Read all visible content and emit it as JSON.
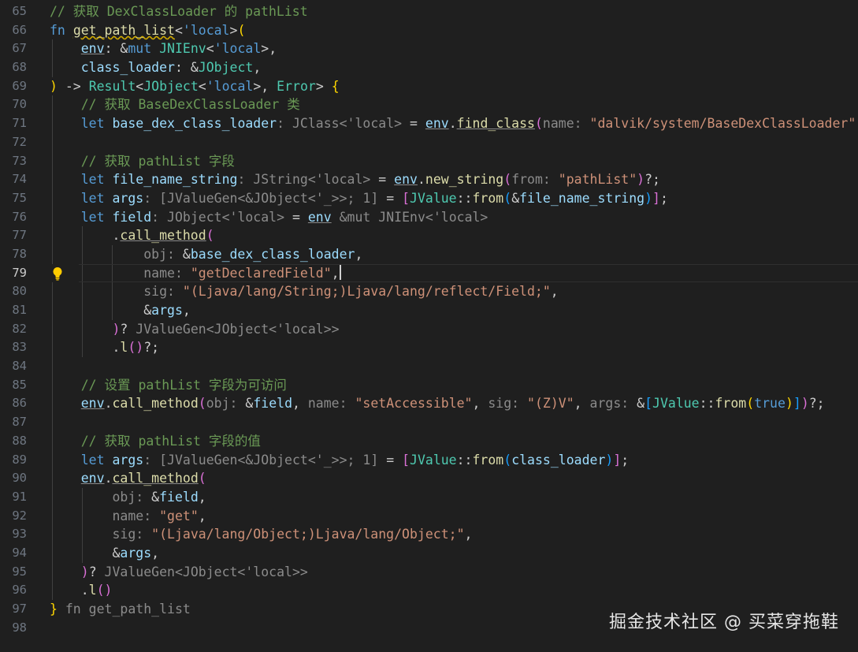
{
  "editor": {
    "current_line": 79,
    "lines": [
      {
        "n": 65,
        "tokens": [
          [
            "cm",
            "// 获取 DexClassLoader 的 pathList"
          ]
        ]
      },
      {
        "n": 66,
        "tokens": [
          [
            "kw",
            "fn "
          ],
          [
            "fn sq",
            "get_path_list"
          ],
          [
            "pn",
            "<"
          ],
          [
            "lt",
            "'local"
          ],
          [
            "pn",
            ">"
          ],
          [
            "b1",
            "("
          ]
        ]
      },
      {
        "n": 67,
        "guides": 1,
        "tokens": [
          [
            "pn",
            "    "
          ],
          [
            "va ul",
            "env"
          ],
          [
            "pn",
            ": &"
          ],
          [
            "kw",
            "mut "
          ],
          [
            "ty",
            "JNIEnv"
          ],
          [
            "pn",
            "<"
          ],
          [
            "lt",
            "'local"
          ],
          [
            "pn",
            ">,"
          ]
        ]
      },
      {
        "n": 68,
        "guides": 1,
        "tokens": [
          [
            "pn",
            "    "
          ],
          [
            "va",
            "class_loader"
          ],
          [
            "pn",
            ": &"
          ],
          [
            "ty",
            "JObject"
          ],
          [
            "pn",
            ","
          ]
        ]
      },
      {
        "n": 69,
        "tokens": [
          [
            "b1",
            ")"
          ],
          [
            "pn",
            " -> "
          ],
          [
            "ty",
            "Result"
          ],
          [
            "pn",
            "<"
          ],
          [
            "ty",
            "JObject"
          ],
          [
            "pn",
            "<"
          ],
          [
            "lt",
            "'local"
          ],
          [
            "pn",
            ">, "
          ],
          [
            "ty",
            "Error"
          ],
          [
            "pn",
            "> "
          ],
          [
            "b1",
            "{"
          ]
        ]
      },
      {
        "n": 70,
        "guides": 1,
        "tokens": [
          [
            "pn",
            "    "
          ],
          [
            "cm",
            "// 获取 BaseDexClassLoader 类"
          ]
        ]
      },
      {
        "n": 71,
        "guides": 1,
        "tokens": [
          [
            "pn",
            "    "
          ],
          [
            "kw",
            "let "
          ],
          [
            "va",
            "base_dex_class_loader"
          ],
          [
            "h",
            ": JClass<'local>"
          ],
          [
            "pn",
            " = "
          ],
          [
            "va ul",
            "env"
          ],
          [
            "pn",
            "."
          ],
          [
            "fn ul",
            "find_class"
          ],
          [
            "b2",
            "("
          ],
          [
            "h",
            "name: "
          ],
          [
            "st",
            "\"dalvik/system/BaseDexClassLoader\""
          ],
          [
            "b2",
            ")"
          ],
          [
            "pn",
            "?;"
          ]
        ]
      },
      {
        "n": 72,
        "guides": 1,
        "tokens": []
      },
      {
        "n": 73,
        "guides": 1,
        "tokens": [
          [
            "pn",
            "    "
          ],
          [
            "cm",
            "// 获取 pathList 字段"
          ]
        ]
      },
      {
        "n": 74,
        "guides": 1,
        "tokens": [
          [
            "pn",
            "    "
          ],
          [
            "kw",
            "let "
          ],
          [
            "va",
            "file_name_string"
          ],
          [
            "h",
            ": JString<'local>"
          ],
          [
            "pn",
            " = "
          ],
          [
            "va ul",
            "env"
          ],
          [
            "pn",
            "."
          ],
          [
            "fn",
            "new_string"
          ],
          [
            "b2",
            "("
          ],
          [
            "h",
            "from: "
          ],
          [
            "st",
            "\"pathList\""
          ],
          [
            "b2",
            ")"
          ],
          [
            "pn",
            "?;"
          ]
        ]
      },
      {
        "n": 75,
        "guides": 1,
        "tokens": [
          [
            "pn",
            "    "
          ],
          [
            "kw",
            "let "
          ],
          [
            "va",
            "args"
          ],
          [
            "h",
            ": [JValueGen<&JObject<'_>>; 1]"
          ],
          [
            "pn",
            " = "
          ],
          [
            "b2",
            "["
          ],
          [
            "ty",
            "JValue"
          ],
          [
            "pn",
            "::"
          ],
          [
            "fn",
            "from"
          ],
          [
            "b3",
            "("
          ],
          [
            "pn",
            "&"
          ],
          [
            "va",
            "file_name_string"
          ],
          [
            "b3",
            ")"
          ],
          [
            "b2",
            "]"
          ],
          [
            "pn",
            ";"
          ]
        ]
      },
      {
        "n": 76,
        "guides": 1,
        "tokens": [
          [
            "pn",
            "    "
          ],
          [
            "kw",
            "let "
          ],
          [
            "va",
            "field"
          ],
          [
            "h",
            ": JObject<'local>"
          ],
          [
            "pn",
            " = "
          ],
          [
            "va ul",
            "env"
          ],
          [
            "h",
            " &mut JNIEnv<'local>"
          ]
        ]
      },
      {
        "n": 77,
        "guides": 2,
        "tokens": [
          [
            "pn",
            "        ."
          ],
          [
            "fn ul",
            "call_method"
          ],
          [
            "b2",
            "("
          ]
        ]
      },
      {
        "n": 78,
        "guides": 3,
        "tokens": [
          [
            "pn",
            "            "
          ],
          [
            "h",
            "obj: "
          ],
          [
            "pn",
            "&"
          ],
          [
            "va",
            "base_dex_class_loader"
          ],
          [
            "pn",
            ","
          ]
        ]
      },
      {
        "n": 79,
        "guides": 3,
        "bulb": true,
        "tokens": [
          [
            "pn",
            "            "
          ],
          [
            "h",
            "name: "
          ],
          [
            "st",
            "\"getDeclaredField\""
          ],
          [
            "pn",
            ","
          ],
          [
            "cursor",
            ""
          ]
        ]
      },
      {
        "n": 80,
        "guides": 3,
        "tokens": [
          [
            "pn",
            "            "
          ],
          [
            "h",
            "sig: "
          ],
          [
            "st",
            "\"(Ljava/lang/String;)Ljava/lang/reflect/Field;\""
          ],
          [
            "pn",
            ","
          ]
        ]
      },
      {
        "n": 81,
        "guides": 3,
        "tokens": [
          [
            "pn",
            "            &"
          ],
          [
            "va",
            "args"
          ],
          [
            "pn",
            ","
          ]
        ]
      },
      {
        "n": 82,
        "guides": 2,
        "tokens": [
          [
            "pn",
            "        "
          ],
          [
            "b2",
            ")"
          ],
          [
            "pn",
            "?"
          ],
          [
            "h",
            " JValueGen<JObject<'local>>"
          ]
        ]
      },
      {
        "n": 83,
        "guides": 2,
        "tokens": [
          [
            "pn",
            "        ."
          ],
          [
            "fn",
            "l"
          ],
          [
            "b2",
            "()"
          ],
          [
            "pn",
            "?;"
          ]
        ]
      },
      {
        "n": 84,
        "guides": 1,
        "tokens": []
      },
      {
        "n": 85,
        "guides": 1,
        "tokens": [
          [
            "pn",
            "    "
          ],
          [
            "cm",
            "// 设置 pathList 字段为可访问"
          ]
        ]
      },
      {
        "n": 86,
        "guides": 1,
        "tokens": [
          [
            "pn",
            "    "
          ],
          [
            "va ul",
            "env"
          ],
          [
            "pn",
            "."
          ],
          [
            "fn",
            "call_method"
          ],
          [
            "b2",
            "("
          ],
          [
            "h",
            "obj: "
          ],
          [
            "pn",
            "&"
          ],
          [
            "va",
            "field"
          ],
          [
            "pn",
            ", "
          ],
          [
            "h",
            "name: "
          ],
          [
            "st",
            "\"setAccessible\""
          ],
          [
            "pn",
            ", "
          ],
          [
            "h",
            "sig: "
          ],
          [
            "st",
            "\"(Z)V\""
          ],
          [
            "pn",
            ", "
          ],
          [
            "h",
            "args: "
          ],
          [
            "pn",
            "&"
          ],
          [
            "b3",
            "["
          ],
          [
            "ty",
            "JValue"
          ],
          [
            "pn",
            "::"
          ],
          [
            "fn",
            "from"
          ],
          [
            "b1",
            "("
          ],
          [
            "kw",
            "true"
          ],
          [
            "b1",
            ")"
          ],
          [
            "b3",
            "]"
          ],
          [
            "b2",
            ")"
          ],
          [
            "pn",
            "?;"
          ]
        ]
      },
      {
        "n": 87,
        "guides": 1,
        "tokens": []
      },
      {
        "n": 88,
        "guides": 1,
        "tokens": [
          [
            "pn",
            "    "
          ],
          [
            "cm",
            "// 获取 pathList 字段的值"
          ]
        ]
      },
      {
        "n": 89,
        "guides": 1,
        "tokens": [
          [
            "pn",
            "    "
          ],
          [
            "kw",
            "let "
          ],
          [
            "va",
            "args"
          ],
          [
            "h",
            ": [JValueGen<&JObject<'_>>; 1]"
          ],
          [
            "pn",
            " = "
          ],
          [
            "b2",
            "["
          ],
          [
            "ty",
            "JValue"
          ],
          [
            "pn",
            "::"
          ],
          [
            "fn",
            "from"
          ],
          [
            "b3",
            "("
          ],
          [
            "va",
            "class_loader"
          ],
          [
            "b3",
            ")"
          ],
          [
            "b2",
            "]"
          ],
          [
            "pn",
            ";"
          ]
        ]
      },
      {
        "n": 90,
        "guides": 1,
        "tokens": [
          [
            "pn",
            "    "
          ],
          [
            "va ul",
            "env"
          ],
          [
            "pn",
            "."
          ],
          [
            "fn ul",
            "call_method"
          ],
          [
            "b2",
            "("
          ]
        ]
      },
      {
        "n": 91,
        "guides": 2,
        "tokens": [
          [
            "pn",
            "        "
          ],
          [
            "h",
            "obj: "
          ],
          [
            "pn",
            "&"
          ],
          [
            "va",
            "field"
          ],
          [
            "pn",
            ","
          ]
        ]
      },
      {
        "n": 92,
        "guides": 2,
        "tokens": [
          [
            "pn",
            "        "
          ],
          [
            "h",
            "name: "
          ],
          [
            "st",
            "\"get\""
          ],
          [
            "pn",
            ","
          ]
        ]
      },
      {
        "n": 93,
        "guides": 2,
        "tokens": [
          [
            "pn",
            "        "
          ],
          [
            "h",
            "sig: "
          ],
          [
            "st",
            "\"(Ljava/lang/Object;)Ljava/lang/Object;\""
          ],
          [
            "pn",
            ","
          ]
        ]
      },
      {
        "n": 94,
        "guides": 2,
        "tokens": [
          [
            "pn",
            "        &"
          ],
          [
            "va",
            "args"
          ],
          [
            "pn",
            ","
          ]
        ]
      },
      {
        "n": 95,
        "guides": 1,
        "tokens": [
          [
            "pn",
            "    "
          ],
          [
            "b2",
            ")"
          ],
          [
            "pn",
            "?"
          ],
          [
            "h",
            " JValueGen<JObject<'local>>"
          ]
        ]
      },
      {
        "n": 96,
        "guides": 1,
        "tokens": [
          [
            "pn",
            "    ."
          ],
          [
            "fn",
            "l"
          ],
          [
            "b2",
            "()"
          ]
        ]
      },
      {
        "n": 97,
        "tokens": [
          [
            "b1",
            "}"
          ],
          [
            "h",
            " fn get_path_list"
          ]
        ]
      },
      {
        "n": 98,
        "tokens": []
      }
    ]
  },
  "watermark": "掘金技术社区 @ 买菜穿拖鞋"
}
